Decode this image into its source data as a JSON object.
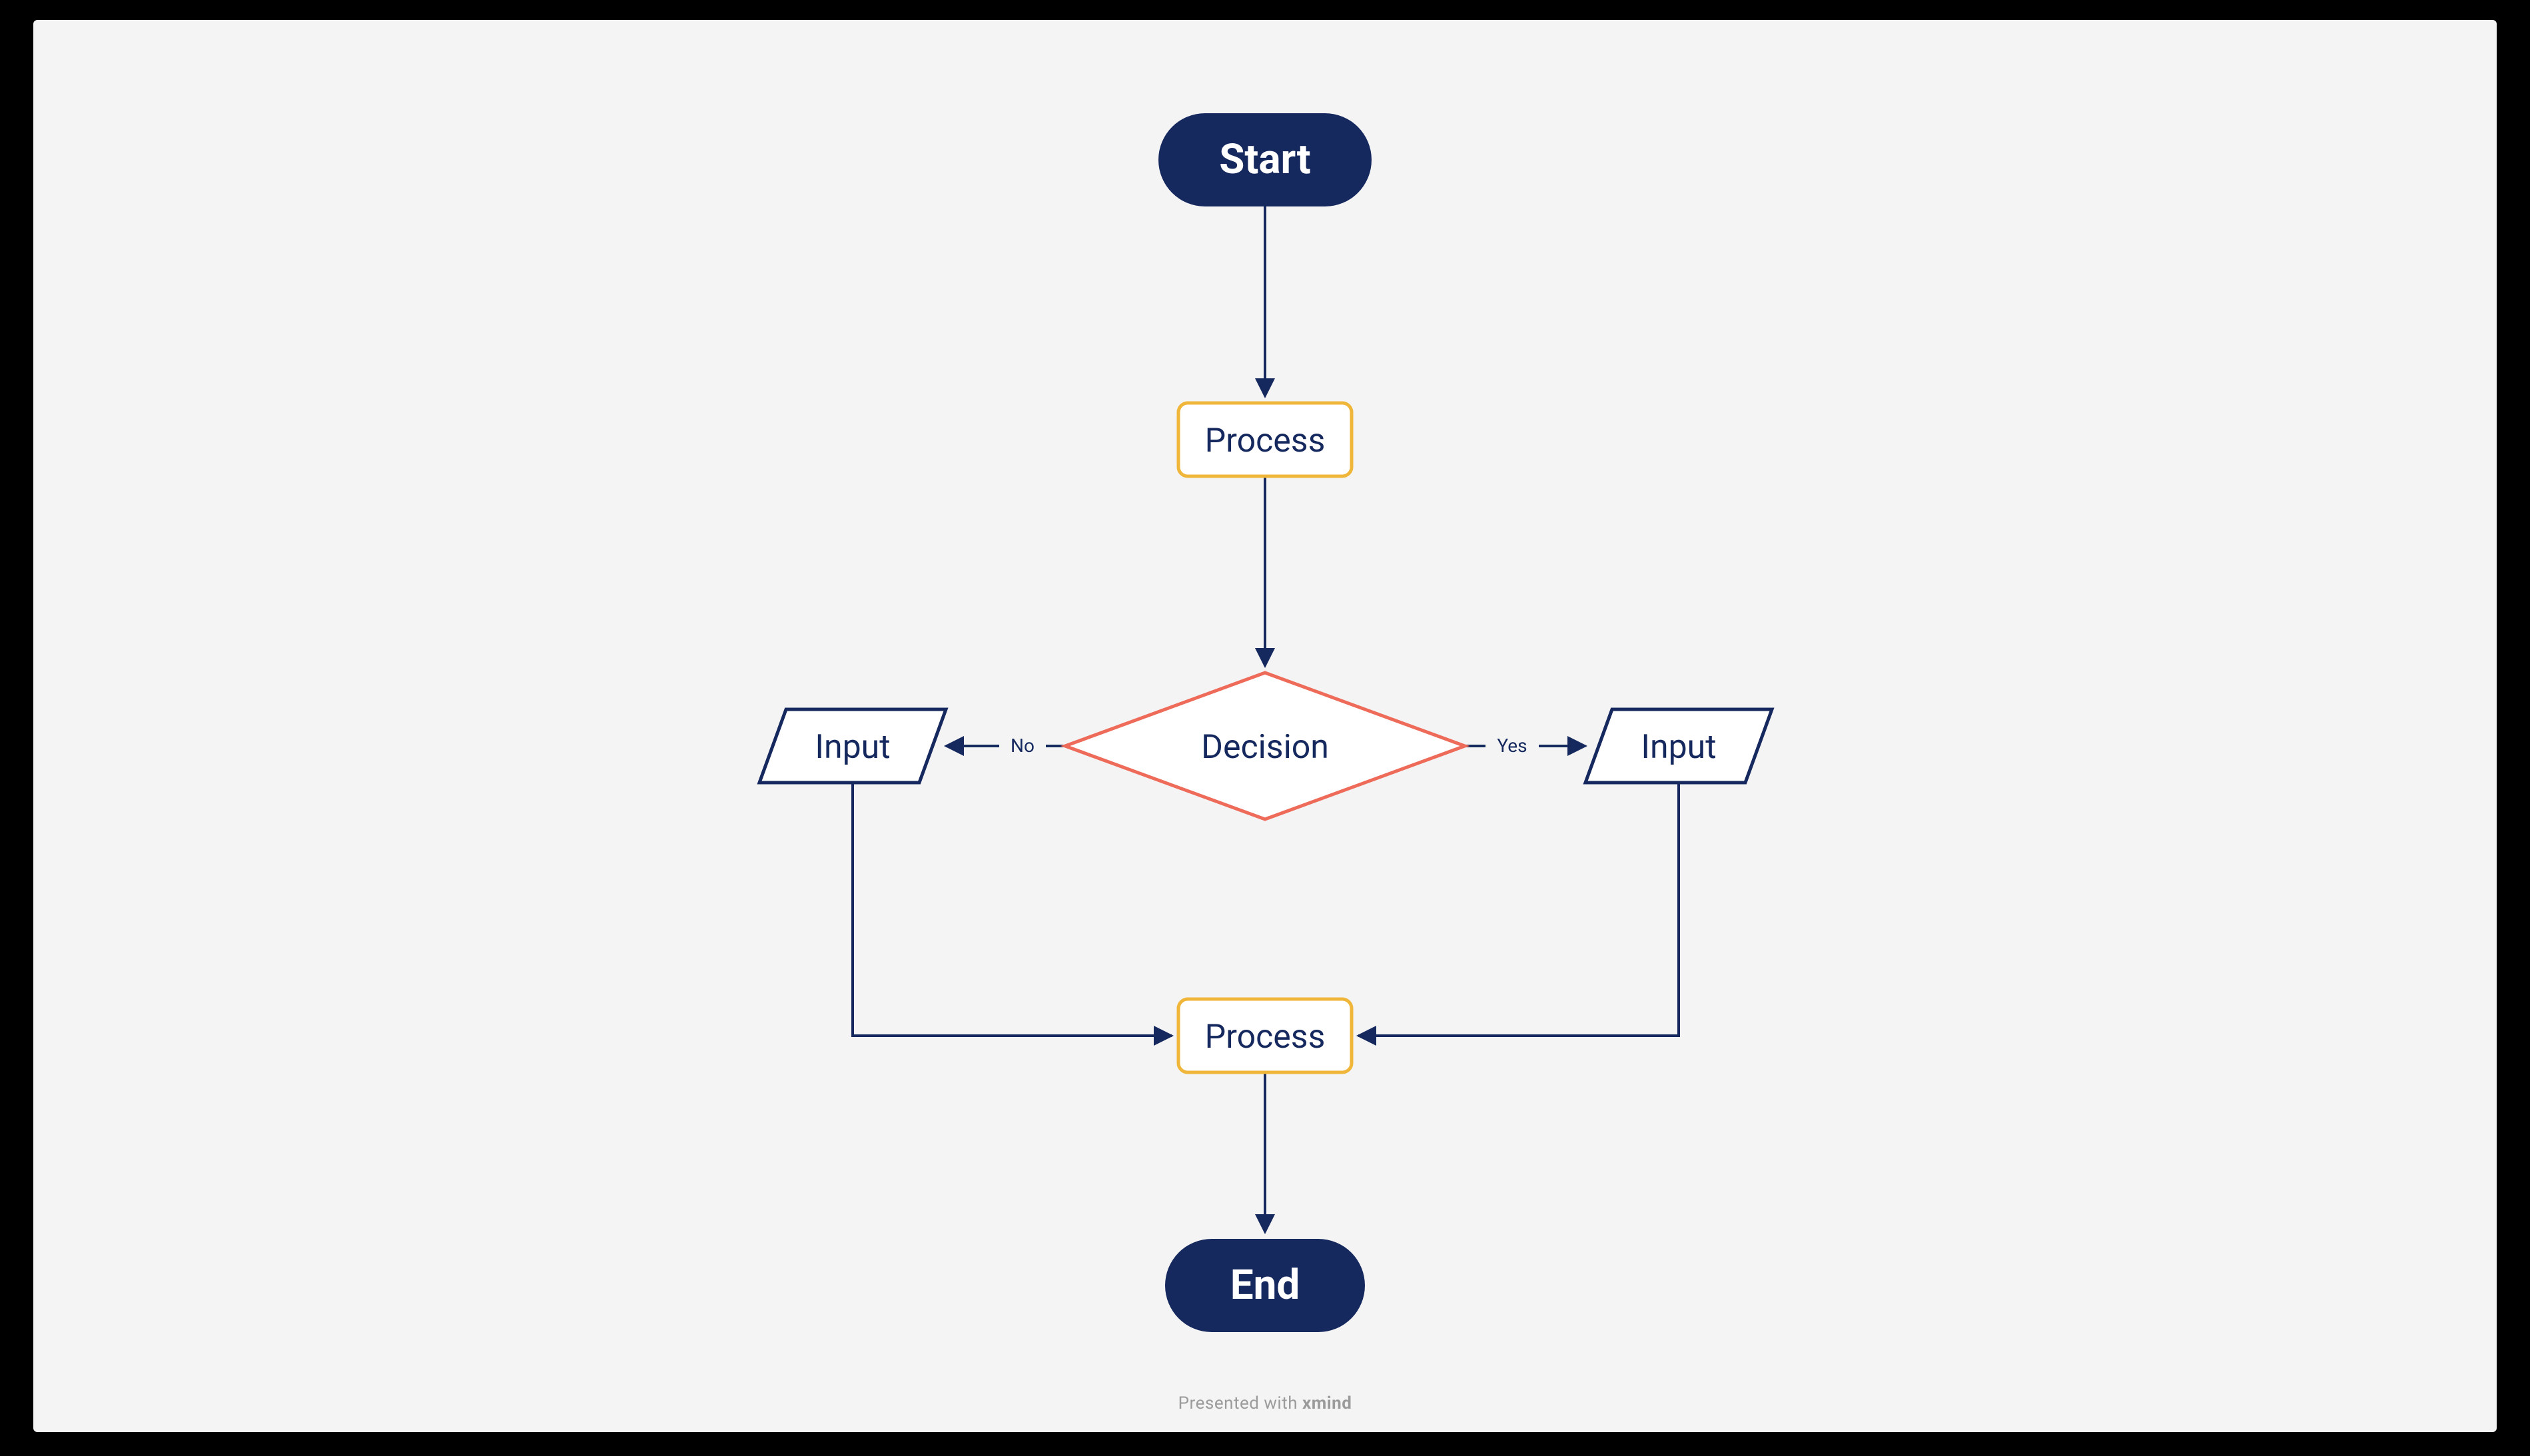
{
  "canvas": {
    "background": "#f4f4f4"
  },
  "colors": {
    "navy": "#16295f",
    "navyStroke": "#16295f",
    "gold": "#f0b63a",
    "coral": "#ee6a59",
    "line": "#16295f",
    "text_light": "#9b9b9b"
  },
  "nodes": {
    "start": {
      "label": "Start",
      "type": "terminator",
      "fill": "#16295f",
      "text": "#ffffff"
    },
    "process1": {
      "label": "Process",
      "type": "process",
      "stroke": "#f0b63a",
      "text": "#16295f"
    },
    "decision": {
      "label": "Decision",
      "type": "decision",
      "stroke": "#ee6a59",
      "text": "#16295f"
    },
    "inputL": {
      "label": "Input",
      "type": "io",
      "stroke": "#16295f",
      "text": "#16295f"
    },
    "inputR": {
      "label": "Input",
      "type": "io",
      "stroke": "#16295f",
      "text": "#16295f"
    },
    "process2": {
      "label": "Process",
      "type": "process",
      "stroke": "#f0b63a",
      "text": "#16295f"
    },
    "end": {
      "label": "End",
      "type": "terminator",
      "fill": "#16295f",
      "text": "#ffffff"
    }
  },
  "edges": {
    "yes": {
      "label": "Yes"
    },
    "no": {
      "label": "No"
    }
  },
  "footer": {
    "prefix": "Presented with ",
    "brand": "xmind"
  }
}
